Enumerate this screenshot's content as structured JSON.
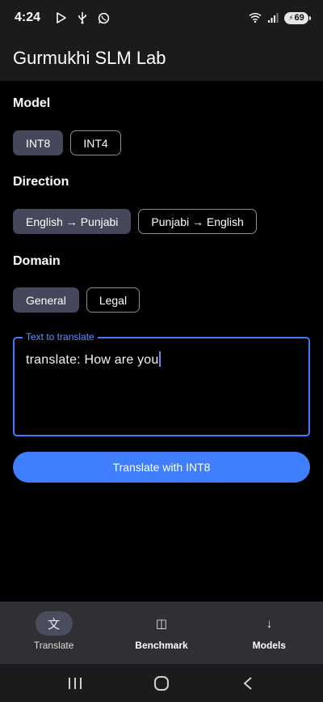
{
  "status_bar": {
    "time": "4:24",
    "battery": "69",
    "icons": [
      "play-store-icon",
      "usb-icon",
      "whatsapp-icon",
      "wifi-icon",
      "signal-icon"
    ]
  },
  "app_bar": {
    "title": "Gurmukhi SLM Lab"
  },
  "model": {
    "label": "Model",
    "options": [
      {
        "label": "INT8",
        "selected": true
      },
      {
        "label": "INT4",
        "selected": false
      }
    ]
  },
  "direction": {
    "label": "Direction",
    "options": [
      {
        "label": "English → Punjabi",
        "selected": true
      },
      {
        "label": "Punjabi → English",
        "selected": false
      }
    ]
  },
  "domain": {
    "label": "Domain",
    "options": [
      {
        "label": "General",
        "selected": true
      },
      {
        "label": "Legal",
        "selected": false
      }
    ]
  },
  "text_field": {
    "label": "Text to translate",
    "value": "translate: How are you"
  },
  "primary_button": {
    "label": "Translate with INT8"
  },
  "bottom_nav": {
    "items": [
      {
        "icon": "文",
        "label": "Translate",
        "active": true
      },
      {
        "icon": "◫",
        "label": "Benchmark",
        "active": false
      },
      {
        "icon": "↓",
        "label": "Models",
        "active": false
      }
    ]
  },
  "colors": {
    "accent": "#3f7fff",
    "chip_selected": "#44485a",
    "bar_background": "#1b1b1d",
    "nav_background": "#302f33"
  }
}
